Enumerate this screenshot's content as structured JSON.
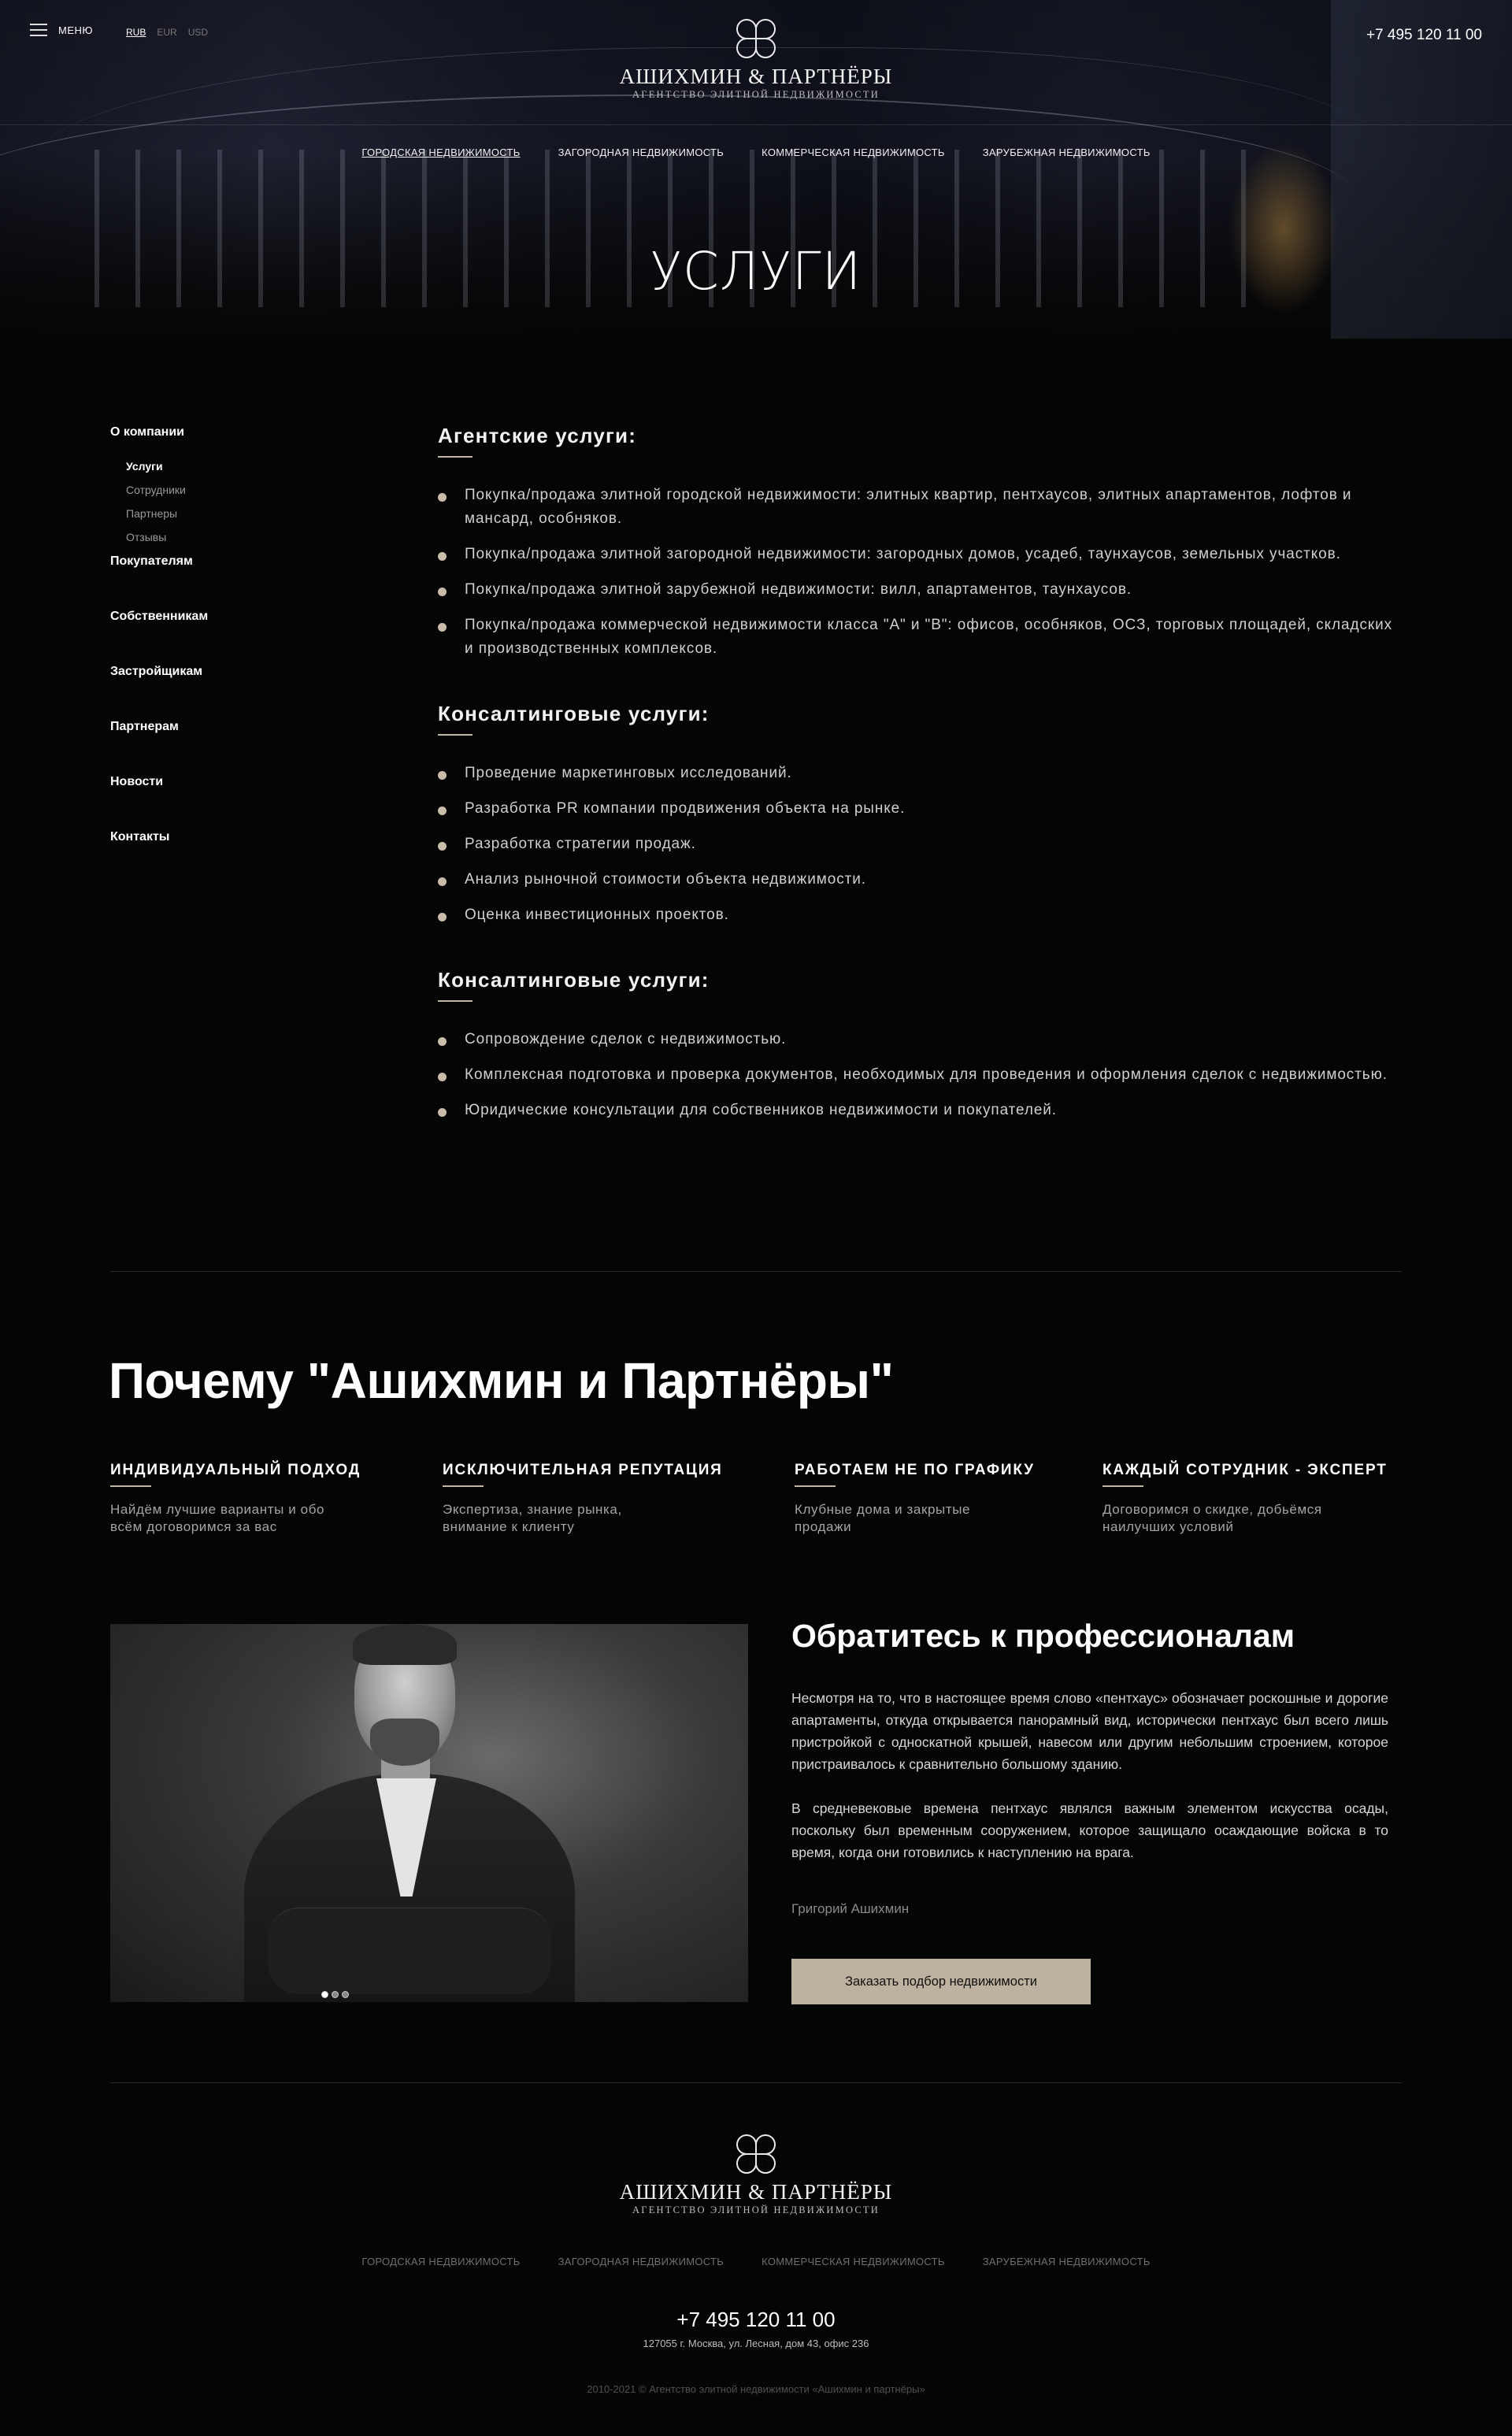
{
  "header": {
    "menu_label": "МЕНЮ",
    "currencies": [
      "RUB",
      "EUR",
      "USD"
    ],
    "active_currency": "RUB",
    "logo_name": "АШИХМИН & ПАРТНЁРЫ",
    "logo_sub": "АГЕНТСТВО ЭЛИТНОЙ НЕДВИЖИМОСТИ",
    "phone": "+7 495 120 11 00",
    "nav": [
      "ГОРОДСКАЯ НЕДВИЖИМОСТЬ",
      "ЗАГОРОДНАЯ НЕДВИЖИМОСТЬ",
      "КОММЕРЧЕСКАЯ НЕДВИЖИМОСТЬ",
      "ЗАРУБЕЖНАЯ НЕДВИЖИМОСТЬ"
    ],
    "active_nav": 0
  },
  "hero": {
    "title": "УСЛУГИ"
  },
  "sidebar": {
    "group_title": "О компании",
    "sub_items": [
      "Услуги",
      "Сотрудники",
      "Партнеры",
      "Отзывы"
    ],
    "active_sub": 0,
    "items": [
      "Покупателям",
      "Собственникам",
      "Застройщикам",
      "Партнерам",
      "Новости",
      "Контакты"
    ]
  },
  "sections": [
    {
      "title": "Агентские услуги:",
      "items": [
        "Покупка/продажа элитной городской недвижимости: элитных квартир, пентхаусов, элитных апартаментов, лофтов и мансард, особняков.",
        "Покупка/продажа элитной загородной недвижимости: загородных домов, усадеб, таунхаусов, земельных участков.",
        "Покупка/продажа элитной зарубежной недвижимости: вилл, апартаментов, таунхаусов.",
        "Покупка/продажа коммерческой недвижимости класса \"А\" и \"В\": офисов, особняков, ОСЗ, торговых площадей, складских и производственных комплексов."
      ]
    },
    {
      "title": "Консалтинговые услуги:",
      "items": [
        "Проведение маркетинговых исследований.",
        "Разработка PR компании продвижения объекта на рынке.",
        "Разработка стратегии продаж.",
        "Анализ рыночной стоимости объекта недвижимости.",
        "Оценка инвестиционных проектов."
      ]
    },
    {
      "title": "Консалтинговые услуги:",
      "items": [
        "Сопровождение сделок с недвижимостью.",
        "Комплексная подготовка и проверка документов, необходимых для проведения и оформления сделок с недвижимостью.",
        "Юридические консультации для собственников недвижимости и покупателей."
      ]
    }
  ],
  "why": {
    "title": "Почему \"Ашихмин и Партнёры\"",
    "features": [
      {
        "title": "ИНДИВИДУАЛЬНЫЙ ПОДХОД",
        "line1": "Найдём лучшие варианты и обо",
        "line2": "всём договоримся за вас"
      },
      {
        "title": "ИСКЛЮЧИТЕЛЬНАЯ РЕПУТАЦИЯ",
        "line1": "Экспертиза, знание рынка,",
        "line2": "внимание к клиенту"
      },
      {
        "title": "РАБОТАЕМ НЕ ПО ГРАФИКУ",
        "line1": "Клубные дома и закрытые",
        "line2": "продажи"
      },
      {
        "title": "КАЖДЫЙ СОТРУДНИК - ЭКСПЕРТ",
        "line1": "Договоримся о скидке, добьёмся",
        "line2": "наилучших условий"
      }
    ]
  },
  "pro": {
    "title": "Обратитесь к профессионалам",
    "paragraph1": "Несмотря на то, что в настоящее время слово «пентхаус» обозначает роскошные и дорогие апартаменты, откуда открывается панорамный вид, исторически пентхаус был всего лишь пристройкой с односкатной крышей, навесом или другим небольшим строением, которое пристраивалось к сравнительно большому зданию.",
    "paragraph2": "В средневековые времена пентхаус являлся важным элементом искусства осады, поскольку был временным сооружением, которое защищало осаждающие войска в то время, когда они готовились к наступлению на врага.",
    "author": "Григорий Ашихмин",
    "button": "Заказать подбор недвижимости",
    "slides": 3,
    "active_slide": 0
  },
  "footer": {
    "logo_name": "АШИХМИН & ПАРТНЁРЫ",
    "logo_sub": "АГЕНТСТВО ЭЛИТНОЙ НЕДВИЖИМОСТИ",
    "nav": [
      "ГОРОДСКАЯ НЕДВИЖИМОСТЬ",
      "ЗАГОРОДНАЯ НЕДВИЖИМОСТЬ",
      "КОММЕРЧЕСКАЯ НЕДВИЖИМОСТЬ",
      "ЗАРУБЕЖНАЯ НЕДВИЖИМОСТЬ"
    ],
    "phone": "+7 495 120 11 00",
    "address": "127055 г. Москва, ул. Лесная, дом 43, офис 236",
    "copyright": "2010-2021 © Агентство элитной недвижимости «Ашихмин и партнёры»"
  },
  "colors": {
    "accent": "#bdb19f",
    "background": "#050505",
    "bullet": "#c9bca9"
  }
}
